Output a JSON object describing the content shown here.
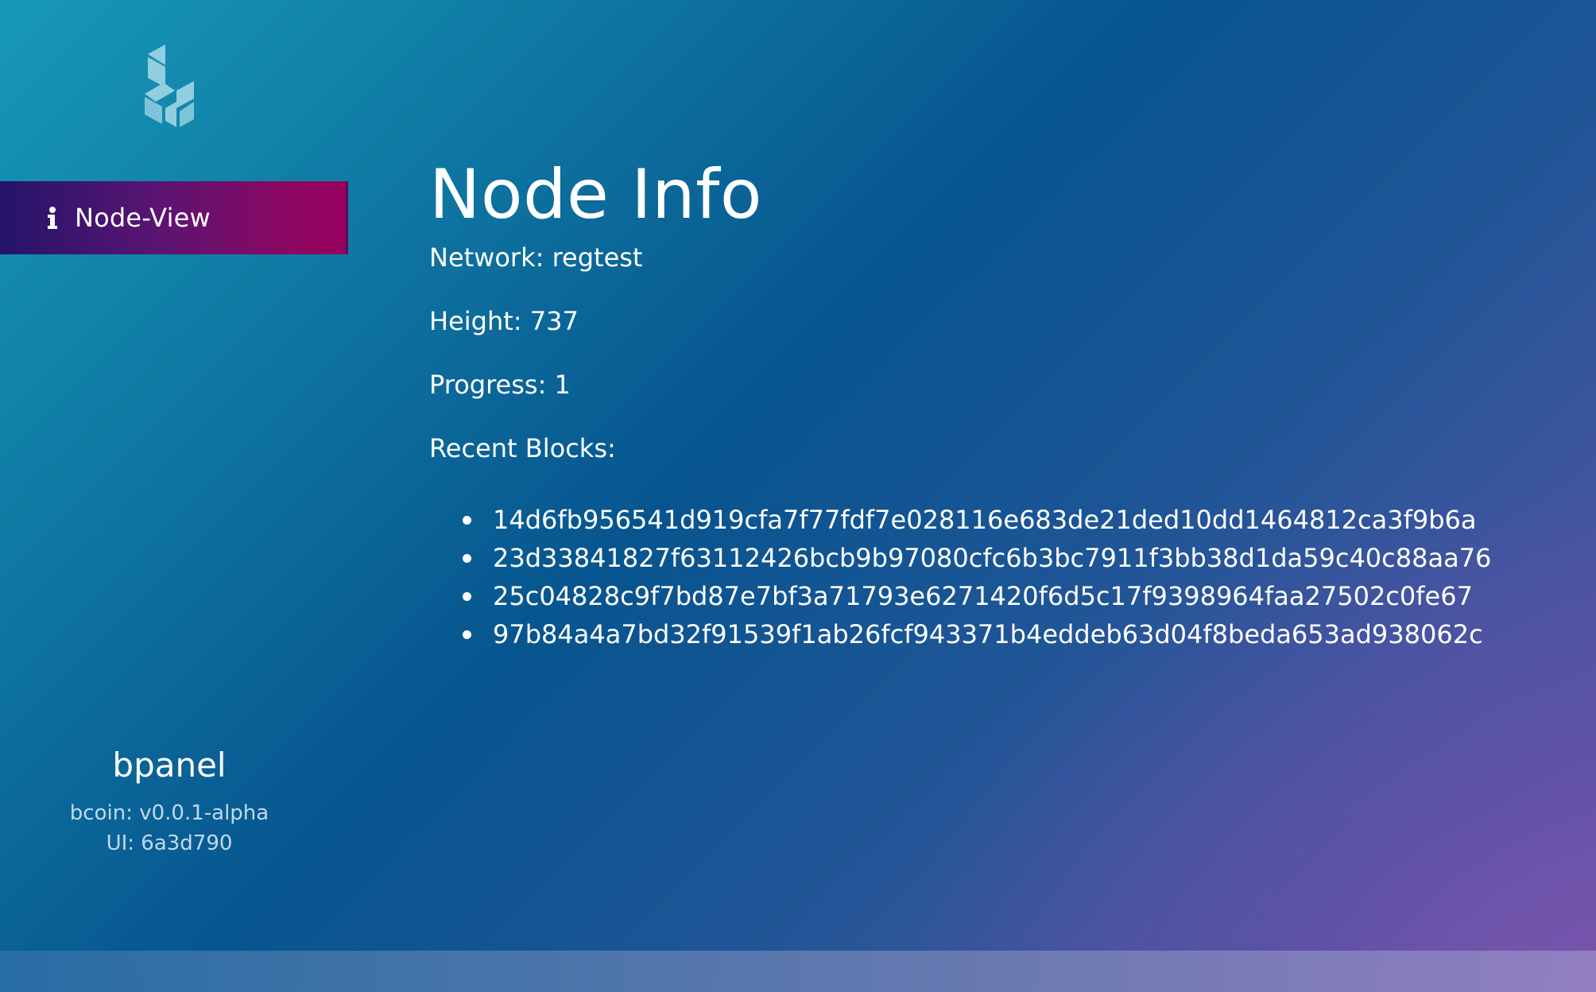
{
  "sidebar": {
    "logo_icon": "bcoin-logo-icon",
    "nav_items": [
      {
        "icon": "info-icon",
        "label": "Node-View",
        "active": true
      }
    ],
    "brand": {
      "name": "bpanel",
      "bcoin_version": "bcoin: v0.0.1-alpha",
      "ui_version": "UI: 6a3d790"
    }
  },
  "main": {
    "title": "Node Info",
    "network": "Network: regtest",
    "height": "Height: 737",
    "progress": "Progress: 1",
    "recent_blocks_label": "Recent Blocks:",
    "recent_blocks": [
      "14d6fb956541d919cfa7f77fdf7e028116e683de21ded10dd1464812ca3f9b6a",
      "23d33841827f63112426bcb9b97080cfc6b3bc7911f3bb38d1da59c40c88aa76",
      "25c04828c9f7bd87e7bf3a71793e6271420f6d5c17f9398964faa27502c0fe67",
      "97b84a4a7bd32f91539f1ab26fcf943371b4eddeb63d04f8beda653ad938062c"
    ]
  },
  "colors": {
    "nav_active_start": "#23156a",
    "nav_active_end": "#98005d",
    "background_start": "#1799b6",
    "background_mid": "#07558f",
    "background_end": "#7a5aac"
  }
}
